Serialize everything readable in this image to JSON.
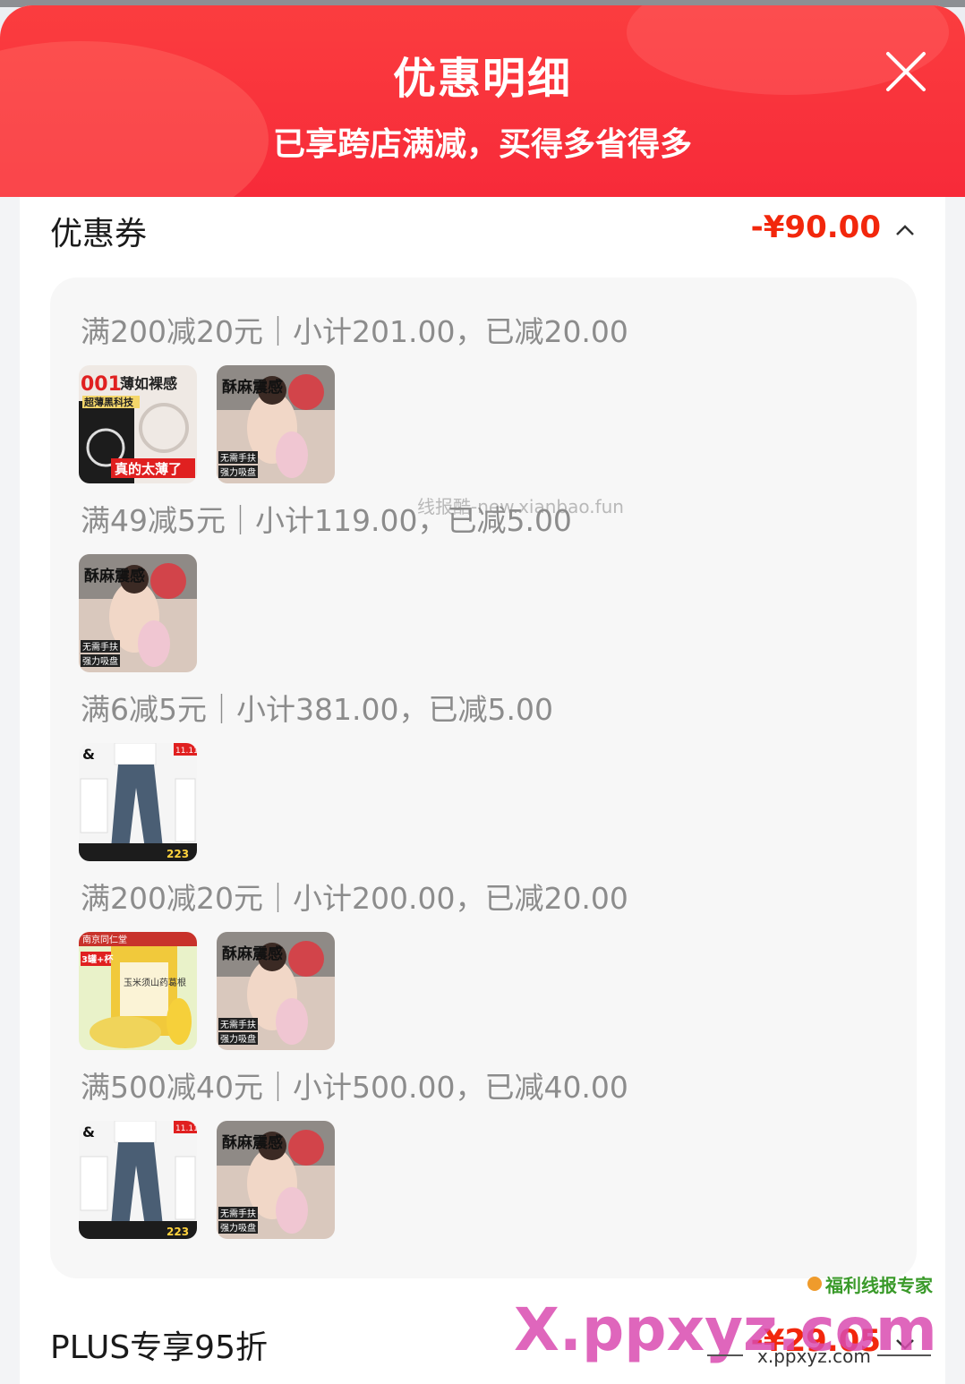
{
  "header": {
    "title": "优惠明细",
    "subtitle": "已享跨店满减，买得多省得多"
  },
  "coupons": {
    "title": "优惠券",
    "amount": "-¥90.00",
    "rules": [
      "满200减20元｜小计201.00，已减20.00",
      "满49减5元｜小计119.00，已减5.00",
      "满6减5元｜小计381.00，已减5.00",
      "满200减20元｜小计200.00，已减20.00",
      "满500减40元｜小计500.00，已减40.00"
    ]
  },
  "plus": {
    "title": "PLUS专享95折",
    "amount": "-¥29.05"
  },
  "product_texts": {
    "condom_tag": "001",
    "condom_title": "薄如裸感",
    "condom_sub": "超薄黑科技",
    "condom_badge": "真的太薄了",
    "toy_title": "酥麻震感",
    "toy_line1": "无需手扶",
    "toy_line2": "强力吸盘",
    "jeans_logo": "&",
    "jeans_price": "223",
    "jeans_corner": "11.11",
    "food_brand": "南京同仁堂",
    "food_tag": "3罐+杯",
    "food_name": "玉米须山药葛根"
  },
  "watermarks": {
    "center": "线报酷-new.xianbao.fun",
    "site": "X.ppxyz.com",
    "site_small": "x.ppxyz.com",
    "brand": "福利线报专家"
  },
  "colors": {
    "banner_red": "#fb3d3f",
    "price_red": "#f2270c",
    "panel_bg": "#f7f7f7"
  }
}
